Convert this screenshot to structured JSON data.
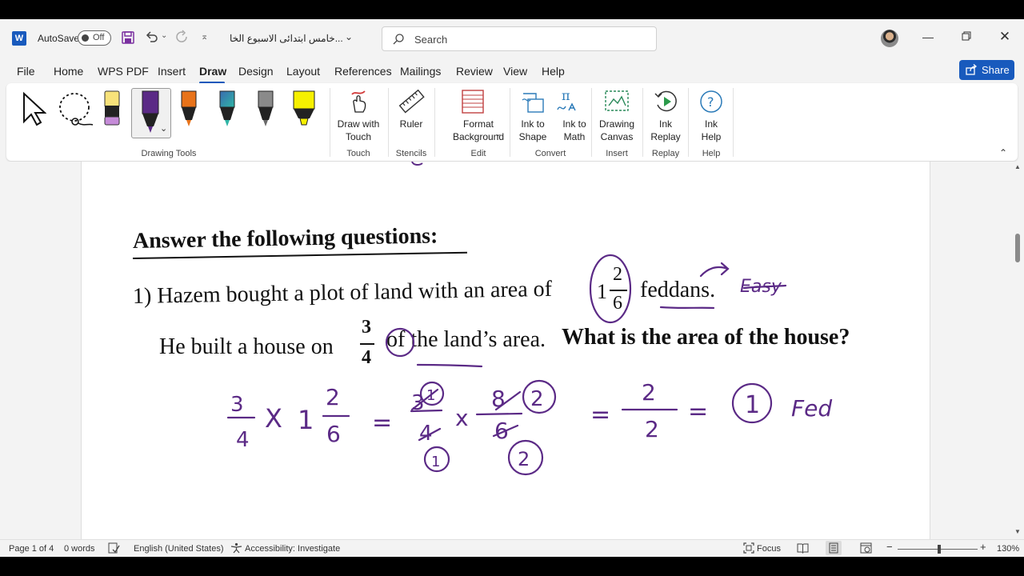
{
  "titlebar": {
    "app_icon": "W",
    "autosave_label": "AutoSave",
    "autosave_state": "Off",
    "doc_title": "خامس ابتدائى الاسبوع الخا...",
    "search_placeholder": "Search"
  },
  "menu": {
    "tabs": [
      "File",
      "Home",
      "WPS PDF",
      "Insert",
      "Draw",
      "Design",
      "Layout",
      "References",
      "Mailings",
      "Review",
      "View",
      "Help"
    ],
    "share_label": "Share"
  },
  "ribbon": {
    "draw_with_touch": "Draw with\nTouch",
    "ruler": "Ruler",
    "format_background": "Format\nBackground",
    "ink_to_shape": "Ink to\nShape",
    "ink_to_math": "Ink to\nMath",
    "drawing_canvas": "Drawing\nCanvas",
    "ink_replay": "Ink\nReplay",
    "ink_help": "Ink\nHelp",
    "groups": {
      "drawing_tools": "Drawing Tools",
      "touch": "Touch",
      "stencils": "Stencils",
      "edit": "Edit",
      "convert": "Convert",
      "insert": "Insert",
      "replay": "Replay",
      "help": "Help"
    },
    "pen_colors": [
      "#f7e27a",
      "#5b2a86",
      "#e8731a",
      "#2a6e8f",
      "#3c3c3c",
      "#f6f000"
    ]
  },
  "document": {
    "heading": "Answer the following questions:",
    "q1_prefix": "1) Hazem bought a plot of land with an area of",
    "q1_whole": "1",
    "q1_num": "2",
    "q1_den": "6",
    "q1_suffix": "feddans.",
    "q1_line2_prefix": "He built a house on",
    "frac_num": "3",
    "frac_den": "4",
    "q1_line2_mid": "of the land’s area.",
    "q1_question": "What is the area of the house?",
    "ink": {
      "note_word": "Easy",
      "t1": "3",
      "t2": "4",
      "t3": "X",
      "t4": "1",
      "t5": "2",
      "t6": "6",
      "t7": "=",
      "t8": "3",
      "t9": "1",
      "t10": "4",
      "t11": "1",
      "t12": "x",
      "t13": "8",
      "t14": "2",
      "t15": "6",
      "t16": "2",
      "t17": "=",
      "t18": "2",
      "t19": "2",
      "t20": "=",
      "t21": "1",
      "t22": "Fed"
    }
  },
  "status": {
    "page": "Page 1 of 4",
    "words": "0 words",
    "language": "English (United States)",
    "accessibility": "Accessibility: Investigate",
    "focus": "Focus",
    "zoom": "130%"
  }
}
